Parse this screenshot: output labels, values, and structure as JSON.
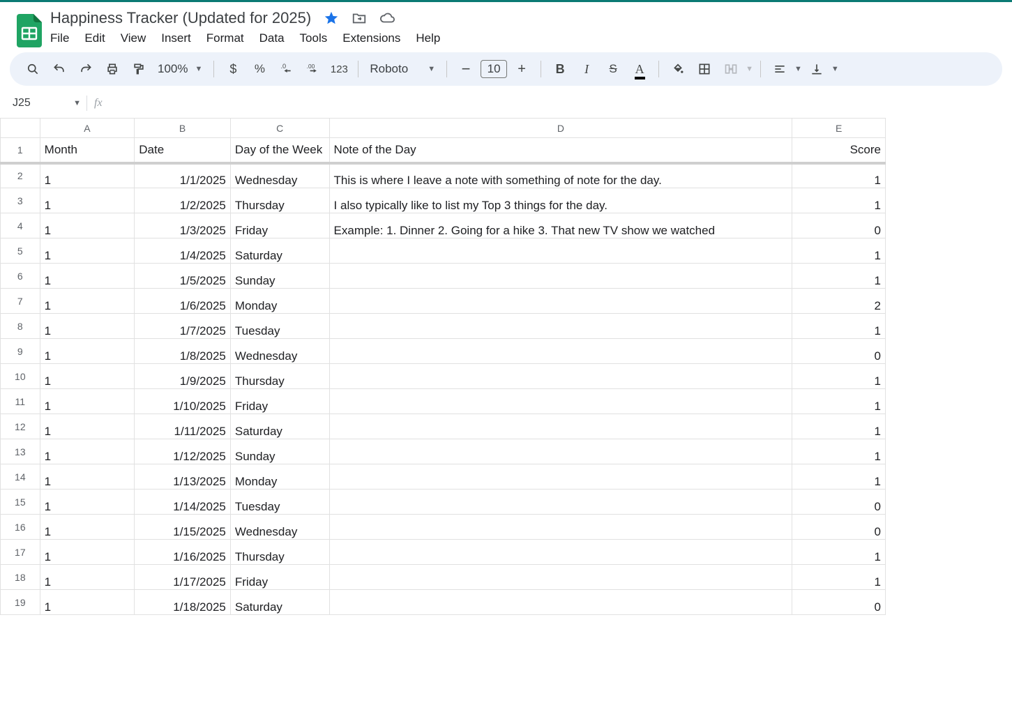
{
  "doc": {
    "title": "Happiness Tracker (Updated for 2025)"
  },
  "menus": {
    "file": "File",
    "edit": "Edit",
    "view": "View",
    "insert": "Insert",
    "format": "Format",
    "data": "Data",
    "tools": "Tools",
    "extensions": "Extensions",
    "help": "Help"
  },
  "toolbar": {
    "zoom": "100%",
    "font": "Roboto",
    "fontsize": "10",
    "numfmt_auto": "123"
  },
  "namebox": "J25",
  "columns": [
    "A",
    "B",
    "C",
    "D",
    "E"
  ],
  "headers": {
    "month": "Month",
    "date": "Date",
    "dow": "Day of the Week",
    "note": "Note of the Day",
    "score": "Score"
  },
  "rows": [
    {
      "n": "1"
    },
    {
      "n": "2",
      "month": "1",
      "date": "1/1/2025",
      "dow": "Wednesday",
      "note": "This is where I leave a note with something of note for the day.",
      "score": "1"
    },
    {
      "n": "3",
      "month": "1",
      "date": "1/2/2025",
      "dow": "Thursday",
      "note": "I also typically like to list my Top 3 things for the day.",
      "score": "1"
    },
    {
      "n": "4",
      "month": "1",
      "date": "1/3/2025",
      "dow": "Friday",
      "note": "Example: 1. Dinner 2. Going for a hike 3. That new TV show we watched",
      "score": "0"
    },
    {
      "n": "5",
      "month": "1",
      "date": "1/4/2025",
      "dow": "Saturday",
      "note": "",
      "score": "1"
    },
    {
      "n": "6",
      "month": "1",
      "date": "1/5/2025",
      "dow": "Sunday",
      "note": "",
      "score": "1"
    },
    {
      "n": "7",
      "month": "1",
      "date": "1/6/2025",
      "dow": "Monday",
      "note": "",
      "score": "2"
    },
    {
      "n": "8",
      "month": "1",
      "date": "1/7/2025",
      "dow": "Tuesday",
      "note": "",
      "score": "1"
    },
    {
      "n": "9",
      "month": "1",
      "date": "1/8/2025",
      "dow": "Wednesday",
      "note": "",
      "score": "0"
    },
    {
      "n": "10",
      "month": "1",
      "date": "1/9/2025",
      "dow": "Thursday",
      "note": "",
      "score": "1"
    },
    {
      "n": "11",
      "month": "1",
      "date": "1/10/2025",
      "dow": "Friday",
      "note": "",
      "score": "1"
    },
    {
      "n": "12",
      "month": "1",
      "date": "1/11/2025",
      "dow": "Saturday",
      "note": "",
      "score": "1"
    },
    {
      "n": "13",
      "month": "1",
      "date": "1/12/2025",
      "dow": "Sunday",
      "note": "",
      "score": "1"
    },
    {
      "n": "14",
      "month": "1",
      "date": "1/13/2025",
      "dow": "Monday",
      "note": "",
      "score": "1"
    },
    {
      "n": "15",
      "month": "1",
      "date": "1/14/2025",
      "dow": "Tuesday",
      "note": "",
      "score": "0"
    },
    {
      "n": "16",
      "month": "1",
      "date": "1/15/2025",
      "dow": "Wednesday",
      "note": "",
      "score": "0"
    },
    {
      "n": "17",
      "month": "1",
      "date": "1/16/2025",
      "dow": "Thursday",
      "note": "",
      "score": "1"
    },
    {
      "n": "18",
      "month": "1",
      "date": "1/17/2025",
      "dow": "Friday",
      "note": "",
      "score": "1"
    },
    {
      "n": "19",
      "month": "1",
      "date": "1/18/2025",
      "dow": "Saturday",
      "note": "",
      "score": "0"
    }
  ]
}
